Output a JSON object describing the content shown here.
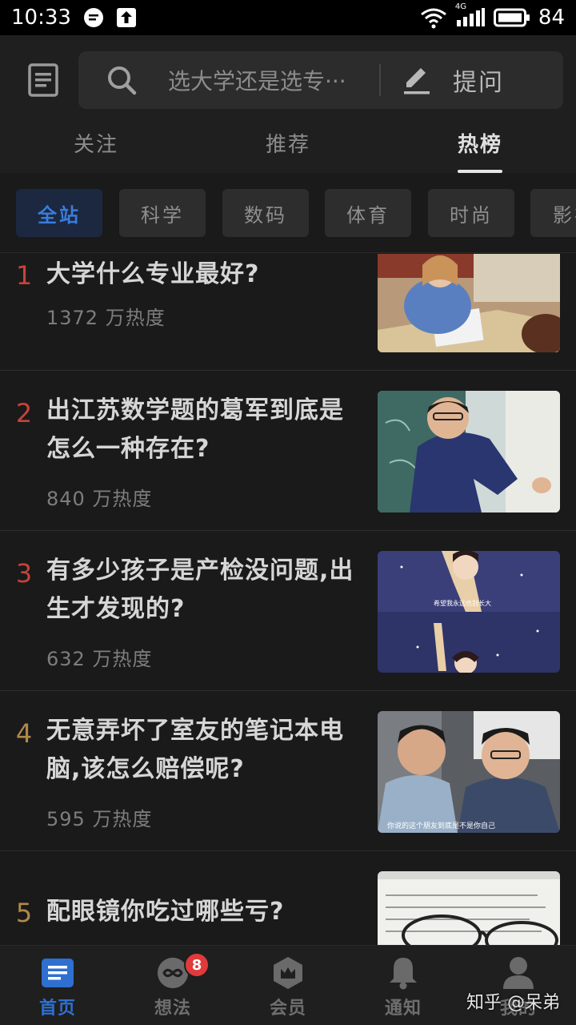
{
  "status_bar": {
    "time": "10:33",
    "network": "4G",
    "battery": "84"
  },
  "header": {
    "search_placeholder": "选大学还是选专···",
    "ask_label": "提问",
    "tabs": [
      {
        "label": "关注"
      },
      {
        "label": "推荐"
      },
      {
        "label": "热榜"
      }
    ]
  },
  "categories": [
    {
      "label": "全站"
    },
    {
      "label": "科学"
    },
    {
      "label": "数码"
    },
    {
      "label": "体育"
    },
    {
      "label": "时尚"
    },
    {
      "label": "影视"
    }
  ],
  "hot_list": [
    {
      "rank": "1",
      "title": "大学什么专业最好?",
      "heat": "1372 万热度",
      "rank_color": "#c8423a"
    },
    {
      "rank": "2",
      "title": "出江苏数学题的葛军到底是怎么一种存在?",
      "heat": "840 万热度",
      "rank_color": "#c8423a"
    },
    {
      "rank": "3",
      "title": "有多少孩子是产检没问题,出生才发现的?",
      "heat": "632 万热度",
      "rank_color": "#c8423a"
    },
    {
      "rank": "4",
      "title": "无意弄坏了室友的笔记本电脑,该怎么赔偿呢?",
      "heat": "595 万热度",
      "rank_color": "#b08a4a"
    },
    {
      "rank": "5",
      "title": "配眼镜你吃过哪些亏?",
      "heat": "",
      "rank_color": "#b08a4a"
    }
  ],
  "thumb_captions": {
    "item3": "希望我永远也别长大",
    "item4": "你说的这个朋友到底是不是你自己"
  },
  "bottom_nav": {
    "items": [
      {
        "label": "首页"
      },
      {
        "label": "想法",
        "badge": "8"
      },
      {
        "label": "会员"
      },
      {
        "label": "通知"
      },
      {
        "label": "我的"
      }
    ]
  },
  "watermark": "知乎 @呆弟",
  "colors": {
    "accent": "#2f6fd0",
    "rank_top": "#c8423a",
    "rank_other": "#b08a4a",
    "badge": "#e03a3a"
  }
}
